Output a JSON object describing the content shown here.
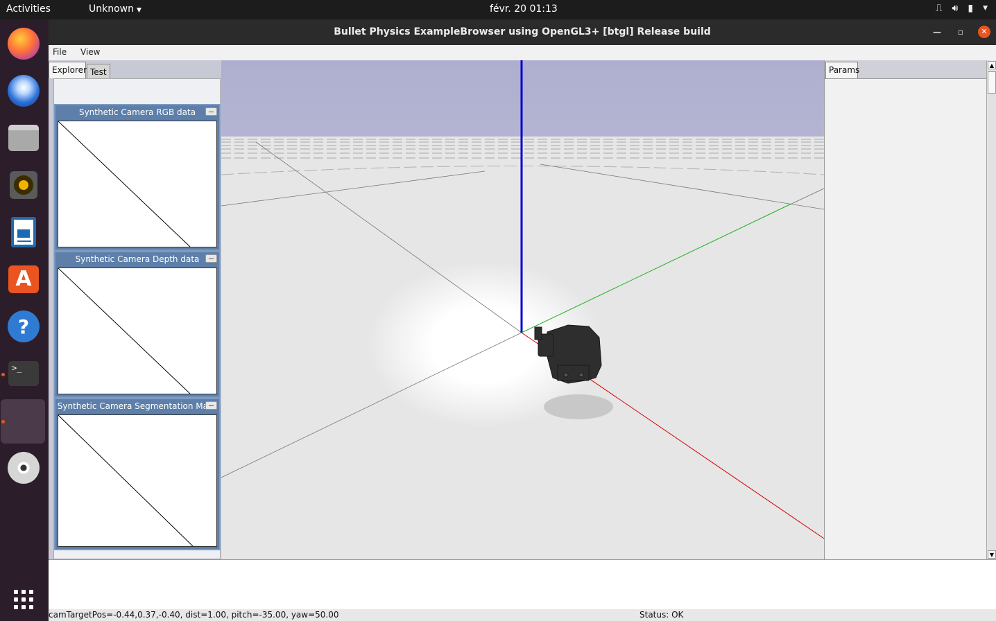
{
  "topbar": {
    "activities": "Activities",
    "app_menu": "Unknown",
    "clock": "févr. 20  01:13"
  },
  "dock": {
    "items": [
      {
        "name": "firefox",
        "icon": "firefox-icon",
        "color": "#e66000"
      },
      {
        "name": "thunderbird",
        "icon": "thunderbird-icon",
        "color": "#2a6fd6"
      },
      {
        "name": "files",
        "icon": "files-icon",
        "color": "#8a8a8a"
      },
      {
        "name": "rhythmbox",
        "icon": "rhythmbox-icon",
        "color": "#f0b400"
      },
      {
        "name": "libreoffice-writer",
        "icon": "writer-icon",
        "color": "#1c6bb0"
      },
      {
        "name": "ubuntu-software",
        "icon": "software-icon",
        "color": "#e95420"
      },
      {
        "name": "help",
        "icon": "help-icon",
        "color": "#2f7bd4"
      },
      {
        "name": "terminal",
        "icon": "terminal-icon",
        "color": "#3a3a3a"
      },
      {
        "name": "bullet-app",
        "icon": "app-window-icon",
        "color": "#4a3a4a"
      },
      {
        "name": "dvd",
        "icon": "dvd-icon",
        "color": "#dcdcdc"
      }
    ],
    "help_glyph": "?",
    "terminal_glyph": ">_"
  },
  "window": {
    "title": "Bullet Physics ExampleBrowser using OpenGL3+ [btgl] Release build",
    "menu": {
      "file": "File",
      "view": "View"
    }
  },
  "left_panel": {
    "tabs": {
      "explorer": "Explorer",
      "test": "Test"
    },
    "camera_windows": [
      {
        "title": "Synthetic Camera RGB data"
      },
      {
        "title": "Synthetic Camera Depth data"
      },
      {
        "title": "Synthetic Camera Segmentation Mask"
      }
    ]
  },
  "right_panel": {
    "tabs": {
      "params": "Params"
    }
  },
  "status": {
    "camera": "camTargetPos=-0.44,0.37,-0.40, dist=1.00, pitch=-35.00, yaw=50.00",
    "state": "Status: OK"
  },
  "colors": {
    "sky": "#aeaed0",
    "ground": "#e6e6e6",
    "axis_x": "#d80000",
    "axis_y": "#20b020",
    "axis_z": "#0000d0",
    "accent": "#e95420"
  }
}
